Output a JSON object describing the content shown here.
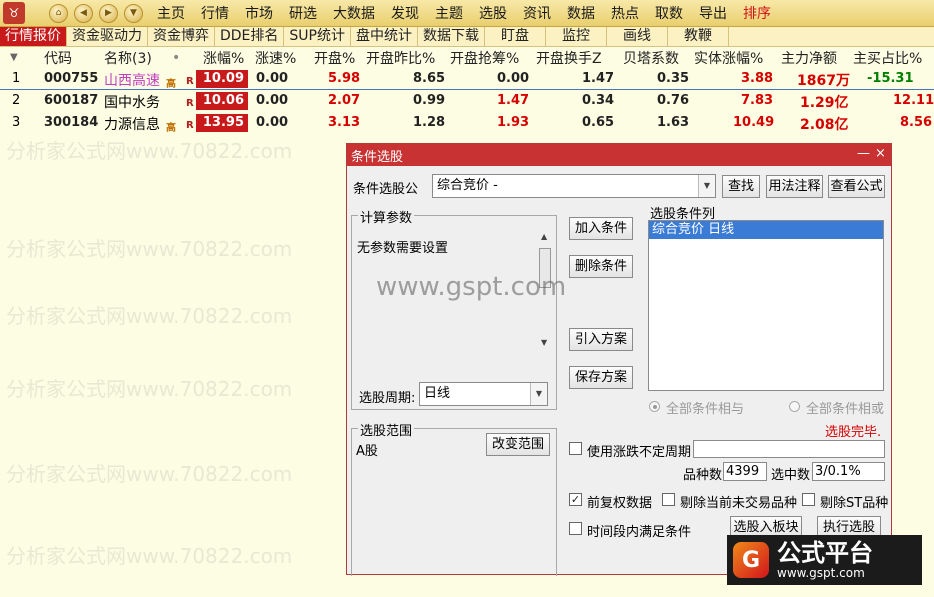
{
  "menu": {
    "items": [
      "主页",
      "行情",
      "市场",
      "研选",
      "大数据",
      "发现",
      "主题",
      "选股",
      "资讯",
      "数据",
      "热点",
      "取数",
      "导出",
      "排序"
    ],
    "active_index": 13
  },
  "tabs": [
    "行情报价",
    "资金驱动力",
    "资金博弈",
    "DDE排名",
    "SUP统计",
    "盘中统计",
    "数据下载",
    "盯盘",
    "监控",
    "画线",
    "教鞭"
  ],
  "columns": {
    "code": "代码",
    "name": "名称(3)",
    "dot": "•",
    "pct": "涨幅%",
    "speed": "涨速%",
    "open": "开盘%",
    "open_prev": "开盘昨比%",
    "open_grab": "开盘抢筹%",
    "open_turnover": "开盘换手Z",
    "beta": "贝塔系数",
    "real_pct": "实体涨幅%",
    "main_net": "主力净额",
    "main_buy": "主买占比%"
  },
  "rows": [
    {
      "idx": "1",
      "code": "000755",
      "name": "山西高速",
      "tag": "高",
      "r": "R",
      "pct": "10.09",
      "speed": "0.00",
      "open": "5.98",
      "open_prev": "8.65",
      "open_grab": "0.00",
      "open_turnover": "1.47",
      "beta": "0.35",
      "real_pct": "3.88",
      "main_net": "1867万",
      "main_buy": "-15.31"
    },
    {
      "idx": "2",
      "code": "600187",
      "name": "国中水务",
      "tag": "",
      "r": "R",
      "pct": "10.06",
      "speed": "0.00",
      "open": "2.07",
      "open_prev": "0.99",
      "open_grab": "1.47",
      "open_turnover": "0.34",
      "beta": "0.76",
      "real_pct": "7.83",
      "main_net": "1.29亿",
      "main_buy": "12.11"
    },
    {
      "idx": "3",
      "code": "300184",
      "name": "力源信息",
      "tag": "高",
      "r": "R",
      "pct": "13.95",
      "speed": "0.00",
      "open": "3.13",
      "open_prev": "1.28",
      "open_grab": "1.93",
      "open_turnover": "0.65",
      "beta": "1.63",
      "real_pct": "10.49",
      "main_net": "2.08亿",
      "main_buy": "8.56"
    }
  ],
  "watermarks": {
    "a": "分析家公式网www.70822.com",
    "b": "www.gspt.com"
  },
  "dialog": {
    "title": "条件选股",
    "minimize": "—",
    "close": "×",
    "formula_label": "条件选股公",
    "formula_value": "综合竞价  -",
    "btn_find": "查找",
    "btn_usage": "用法注释",
    "btn_view": "查看公式",
    "params_group": "计算参数",
    "params_text": "无参数需要设置",
    "btn_add": "加入条件",
    "btn_delete": "删除条件",
    "btn_import": "引入方案",
    "btn_save": "保存方案",
    "list_label": "选股条件列",
    "list_items": [
      "综合竞价  日线"
    ],
    "period_label": "选股周期:",
    "period_value": "日线",
    "radio_and": "全部条件相与",
    "radio_or": "全部条件相或",
    "status": "选股完毕.",
    "range_group": "选股范围",
    "range_value": "A股",
    "btn_change_range": "改变范围",
    "chk_unfixed": "使用涨跌不定周期",
    "count_label": "品种数",
    "count_value": "4399",
    "selected_label": "选中数",
    "selected_value": "3/0.1%",
    "chk_restore": "前复权数据",
    "chk_exclude_untraded": "剔除当前未交易品种",
    "chk_exclude_st": "剔除ST品种",
    "chk_timerange": "时间段内满足条件",
    "btn_to_block": "选股入板块",
    "btn_execute": "执行选股"
  },
  "brand": {
    "logo": "G",
    "name": "公式平台",
    "url": "www.gspt.com"
  }
}
